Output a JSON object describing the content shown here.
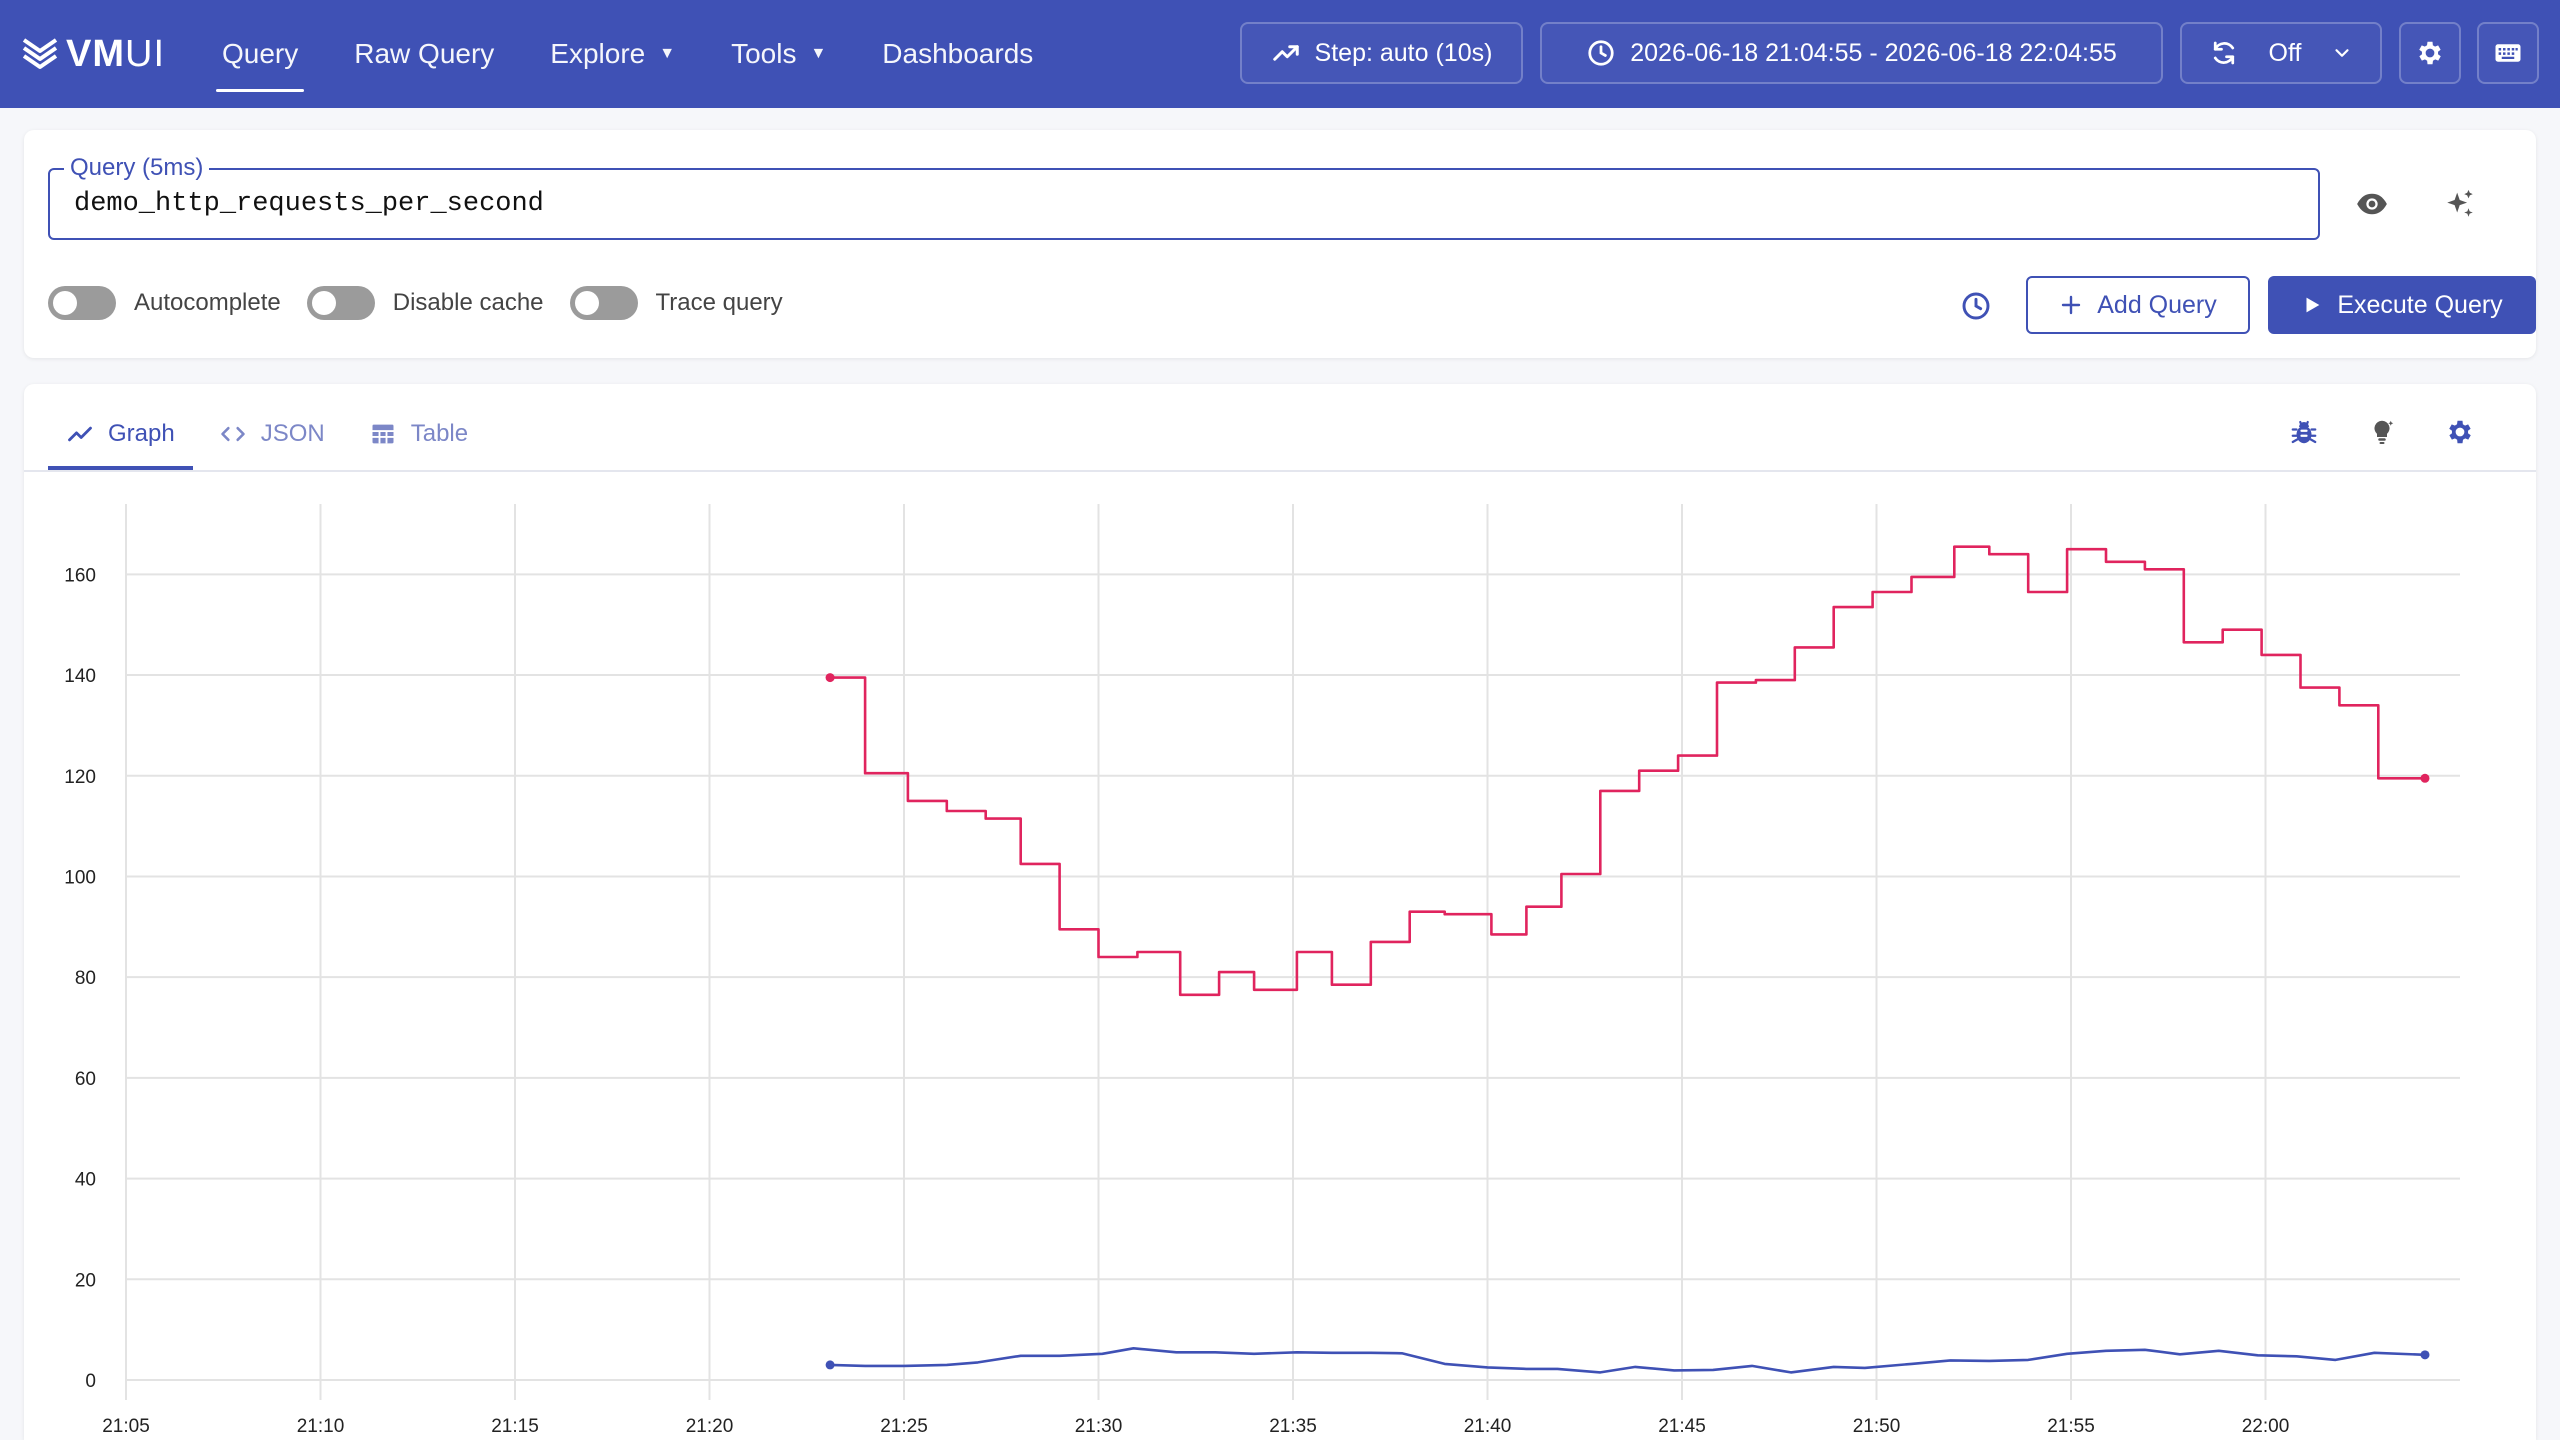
{
  "header": {
    "logo_bold": "VM",
    "logo_light": "UI",
    "nav": [
      {
        "label": "Query",
        "active": true,
        "caret": false
      },
      {
        "label": "Raw Query",
        "active": false,
        "caret": false
      },
      {
        "label": "Explore",
        "active": false,
        "caret": true
      },
      {
        "label": "Tools",
        "active": false,
        "caret": true
      },
      {
        "label": "Dashboards",
        "active": false,
        "caret": false
      }
    ],
    "step_label": "Step: auto (10s)",
    "time_range": "2026-06-18 21:04:55 - 2026-06-18 22:04:55",
    "refresh_label": "Off"
  },
  "query": {
    "legend": "Query (5ms)",
    "value": "demo_http_requests_per_second",
    "toggles": [
      {
        "label": "Autocomplete",
        "on": false
      },
      {
        "label": "Disable cache",
        "on": false
      },
      {
        "label": "Trace query",
        "on": false
      }
    ],
    "add_label": "Add Query",
    "execute_label": "Execute Query"
  },
  "tabs": [
    {
      "label": "Graph",
      "icon": "graph-icon",
      "active": true
    },
    {
      "label": "JSON",
      "icon": "code-icon",
      "active": false
    },
    {
      "label": "Table",
      "icon": "table-icon",
      "active": false
    }
  ],
  "chart_data": {
    "type": "line",
    "title": "",
    "xlabel": "",
    "ylabel": "",
    "ylim": [
      0,
      170
    ],
    "yticks": [
      0,
      20,
      40,
      60,
      80,
      100,
      120,
      140,
      160
    ],
    "xticks": [
      "21:05",
      "21:10",
      "21:15",
      "21:20",
      "21:25",
      "21:30",
      "21:35",
      "21:40",
      "21:45",
      "21:50",
      "21:55",
      "22:00"
    ],
    "x_unit": "minutes past 21:00",
    "xlim": [
      5,
      65
    ],
    "grid": true,
    "series": [
      {
        "color": "#e0245e",
        "step": true,
        "points": [
          [
            23.1,
            139.5
          ],
          [
            24.0,
            120.5
          ],
          [
            25.1,
            115
          ],
          [
            26.1,
            113
          ],
          [
            27.1,
            111.5
          ],
          [
            28.0,
            102.5
          ],
          [
            29.0,
            89.5
          ],
          [
            30.0,
            84
          ],
          [
            31.0,
            85
          ],
          [
            32.1,
            76.5
          ],
          [
            33.1,
            81
          ],
          [
            34.0,
            77.5
          ],
          [
            35.1,
            85
          ],
          [
            36.0,
            78.5
          ],
          [
            37.0,
            87
          ],
          [
            38.0,
            93
          ],
          [
            38.9,
            92.5
          ],
          [
            40.1,
            88.5
          ],
          [
            41.0,
            94
          ],
          [
            41.9,
            100.5
          ],
          [
            42.9,
            117
          ],
          [
            43.9,
            121
          ],
          [
            44.9,
            124
          ],
          [
            45.9,
            138.5
          ],
          [
            46.9,
            139
          ],
          [
            47.9,
            145.5
          ],
          [
            48.9,
            153.5
          ],
          [
            49.9,
            156.5
          ],
          [
            50.9,
            159.5
          ],
          [
            52.0,
            165.5
          ],
          [
            52.9,
            164
          ],
          [
            53.9,
            156.5
          ],
          [
            54.9,
            165
          ],
          [
            55.9,
            162.5
          ],
          [
            56.9,
            161
          ],
          [
            57.9,
            146.5
          ],
          [
            58.9,
            149
          ],
          [
            59.9,
            144
          ],
          [
            60.9,
            137.5
          ],
          [
            61.9,
            134
          ],
          [
            62.9,
            119.5
          ],
          [
            64.1,
            119.5
          ]
        ]
      },
      {
        "color": "#3f51b5",
        "step": false,
        "points": [
          [
            23.1,
            3
          ],
          [
            24.0,
            2.8
          ],
          [
            25.0,
            2.8
          ],
          [
            26.1,
            3
          ],
          [
            26.9,
            3.5
          ],
          [
            28.0,
            4.8
          ],
          [
            29.0,
            4.8
          ],
          [
            30.1,
            5.2
          ],
          [
            30.9,
            6.3
          ],
          [
            32.0,
            5.5
          ],
          [
            33.0,
            5.5
          ],
          [
            34.0,
            5.2
          ],
          [
            35.1,
            5.5
          ],
          [
            36.0,
            5.4
          ],
          [
            37.0,
            5.4
          ],
          [
            37.8,
            5.3
          ],
          [
            38.9,
            3.2
          ],
          [
            40.0,
            2.5
          ],
          [
            41.0,
            2.2
          ],
          [
            41.8,
            2.2
          ],
          [
            42.9,
            1.5
          ],
          [
            43.8,
            2.6
          ],
          [
            44.8,
            1.9
          ],
          [
            45.8,
            2.0
          ],
          [
            46.8,
            2.8
          ],
          [
            47.8,
            1.5
          ],
          [
            48.9,
            2.6
          ],
          [
            49.7,
            2.4
          ],
          [
            50.9,
            3.2
          ],
          [
            51.9,
            3.9
          ],
          [
            52.9,
            3.8
          ],
          [
            53.9,
            4.0
          ],
          [
            54.9,
            5.2
          ],
          [
            55.9,
            5.8
          ],
          [
            56.9,
            6.0
          ],
          [
            57.8,
            5.1
          ],
          [
            58.8,
            5.8
          ],
          [
            59.8,
            4.9
          ],
          [
            60.8,
            4.7
          ],
          [
            61.8,
            4.0
          ],
          [
            62.8,
            5.4
          ],
          [
            64.1,
            5.0
          ]
        ]
      }
    ]
  }
}
